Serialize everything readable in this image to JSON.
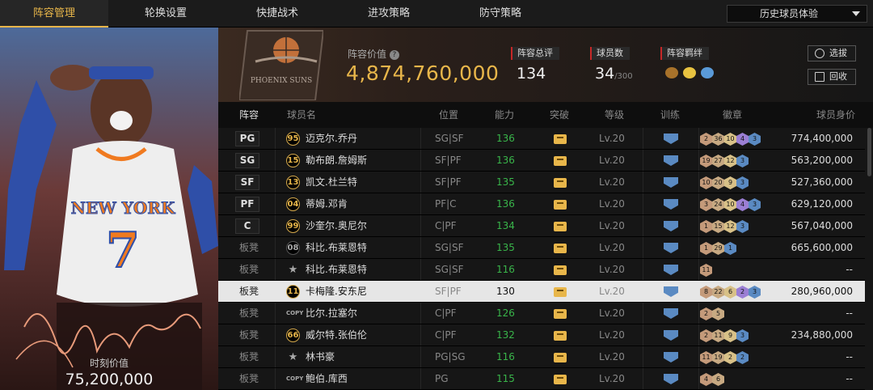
{
  "tabs": [
    "阵容管理",
    "轮换设置",
    "快捷战术",
    "进攻策略",
    "防守策略"
  ],
  "dropdown": "历史球员体验",
  "left": {
    "moment_label": "时刻价值",
    "moment_value": "75,200,000",
    "jersey_team": "NEW YORK",
    "jersey_number": "7"
  },
  "header": {
    "team_logo_text": "PHOENIX SUNS",
    "value_label": "阵容价值",
    "value": "4,874,760,000",
    "overall_label": "阵容总评",
    "overall": "134",
    "count_label": "球员数",
    "count": "34",
    "count_max": "/300",
    "chem_label": "阵容羁绊",
    "btn_select": "选拔",
    "btn_recycle": "回收"
  },
  "columns": [
    "阵容",
    "球员名",
    "位置",
    "能力",
    "突破",
    "等级",
    "训练",
    "徽章",
    "球员身价"
  ],
  "rows": [
    {
      "slot": "PG",
      "starter": true,
      "rank": "95",
      "rank_style": "gold",
      "name": "迈克尔.乔丹",
      "pos": "SG|SF",
      "ability": "136",
      "ability_color": "#39b54a",
      "level": "Lv.20",
      "badges": [
        [
          "2",
          "#c49a7a"
        ],
        [
          "36",
          "#c7a982"
        ],
        [
          "10",
          "#d8c188"
        ],
        [
          "4",
          "#9b7fd4"
        ],
        [
          "3",
          "#5a8ac2"
        ]
      ],
      "worth": "774,400,000"
    },
    {
      "slot": "SG",
      "starter": true,
      "rank": "15",
      "rank_style": "gold",
      "name": "勒布朗.詹姆斯",
      "pos": "SF|PF",
      "ability": "136",
      "ability_color": "#39b54a",
      "level": "Lv.20",
      "badges": [
        [
          "19",
          "#c49a7a"
        ],
        [
          "27",
          "#c7a982"
        ],
        [
          "12",
          "#d8c188"
        ],
        [
          "3",
          "#5a8ac2"
        ]
      ],
      "worth": "563,200,000"
    },
    {
      "slot": "SF",
      "starter": true,
      "rank": "13",
      "rank_style": "gold",
      "name": "凯文.杜兰特",
      "pos": "SF|PF",
      "ability": "135",
      "ability_color": "#39b54a",
      "level": "Lv.20",
      "badges": [
        [
          "10",
          "#c49a7a"
        ],
        [
          "20",
          "#c7a982"
        ],
        [
          "9",
          "#d8c188"
        ],
        [
          "3",
          "#5a8ac2"
        ]
      ],
      "worth": "527,360,000"
    },
    {
      "slot": "PF",
      "starter": true,
      "rank": "04",
      "rank_style": "gold",
      "name": "蒂姆.邓肯",
      "pos": "PF|C",
      "ability": "136",
      "ability_color": "#39b54a",
      "level": "Lv.20",
      "badges": [
        [
          "3",
          "#c49a7a"
        ],
        [
          "24",
          "#c7a982"
        ],
        [
          "10",
          "#d8c188"
        ],
        [
          "4",
          "#9b7fd4"
        ],
        [
          "3",
          "#5a8ac2"
        ]
      ],
      "worth": "629,120,000"
    },
    {
      "slot": "C",
      "starter": true,
      "rank": "99",
      "rank_style": "gold",
      "name": "沙奎尔.奥尼尔",
      "pos": "C|PF",
      "ability": "134",
      "ability_color": "#39b54a",
      "level": "Lv.20",
      "badges": [
        [
          "1",
          "#c49a7a"
        ],
        [
          "15",
          "#c7a982"
        ],
        [
          "12",
          "#d8c188"
        ],
        [
          "3",
          "#5a8ac2"
        ]
      ],
      "worth": "567,040,000"
    },
    {
      "slot": "板凳",
      "starter": false,
      "rank": "08",
      "rank_style": "plain",
      "name": "科比.布莱恩特",
      "pos": "SG|SF",
      "ability": "135",
      "ability_color": "#39b54a",
      "level": "Lv.20",
      "badges": [
        [
          "1",
          "#c49a7a"
        ],
        [
          "29",
          "#c7a982"
        ],
        [
          "1",
          "#5a8ac2"
        ]
      ],
      "worth": "665,600,000"
    },
    {
      "slot": "板凳",
      "starter": false,
      "rank": "★",
      "rank_style": "star",
      "name": "科比.布莱恩特",
      "pos": "SG|SF",
      "ability": "116",
      "ability_color": "#39b54a",
      "level": "Lv.20",
      "badges": [
        [
          "11",
          "#c49a7a"
        ]
      ],
      "worth": "--"
    },
    {
      "slot": "板凳",
      "starter": false,
      "highlight": true,
      "rank": "11",
      "rank_style": "gold",
      "name": "卡梅隆.安东尼",
      "pos": "SF|PF",
      "ability": "130",
      "ability_color": "#111",
      "level": "Lv.20",
      "badges": [
        [
          "8",
          "#c49a7a"
        ],
        [
          "22",
          "#c7a982"
        ],
        [
          "6",
          "#d8c188"
        ],
        [
          "2",
          "#9b7fd4"
        ],
        [
          "3",
          "#5a8ac2"
        ]
      ],
      "worth": "280,960,000"
    },
    {
      "slot": "板凳",
      "starter": false,
      "rank": "COPY",
      "rank_style": "copy",
      "name": "比尔.拉塞尔",
      "pos": "C|PF",
      "ability": "126",
      "ability_color": "#39b54a",
      "level": "Lv.20",
      "badges": [
        [
          "2",
          "#c49a7a"
        ],
        [
          "5",
          "#c7a982"
        ]
      ],
      "worth": "--"
    },
    {
      "slot": "板凳",
      "starter": false,
      "rank": "66",
      "rank_style": "gold",
      "name": "威尔特.张伯伦",
      "pos": "C|PF",
      "ability": "132",
      "ability_color": "#39b54a",
      "level": "Lv.20",
      "badges": [
        [
          "2",
          "#c49a7a"
        ],
        [
          "11",
          "#c7a982"
        ],
        [
          "9",
          "#d8c188"
        ],
        [
          "3",
          "#5a8ac2"
        ]
      ],
      "worth": "234,880,000"
    },
    {
      "slot": "板凳",
      "starter": false,
      "rank": "★",
      "rank_style": "star",
      "name": "林书豪",
      "pos": "PG|SG",
      "ability": "116",
      "ability_color": "#39b54a",
      "level": "Lv.20",
      "badges": [
        [
          "11",
          "#c49a7a"
        ],
        [
          "19",
          "#c7a982"
        ],
        [
          "2",
          "#d8c188"
        ],
        [
          "2",
          "#5a8ac2"
        ]
      ],
      "worth": "--"
    },
    {
      "slot": "板凳",
      "starter": false,
      "rank": "COPY",
      "rank_style": "copy",
      "name": "鲍伯.库西",
      "pos": "PG",
      "ability": "115",
      "ability_color": "#39b54a",
      "level": "Lv.20",
      "badges": [
        [
          "4",
          "#c49a7a"
        ],
        [
          "6",
          "#c7a982"
        ]
      ],
      "worth": "--"
    }
  ]
}
